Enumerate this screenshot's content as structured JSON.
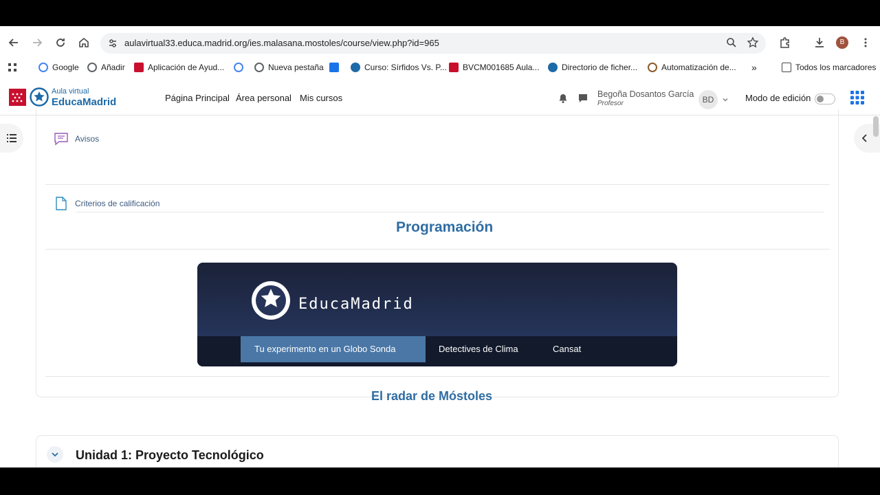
{
  "browser": {
    "url": "aulavirtual33.educa.madrid.org/ies.malasana.mostoles/course/view.php?id=965",
    "profile_initial": "B"
  },
  "bookmarks": [
    {
      "label": "Google",
      "color": "#4285f4"
    },
    {
      "label": "Añadir",
      "color": "#5f6368"
    },
    {
      "label": "Aplicación de Ayud...",
      "color": "#c8102e"
    },
    {
      "label": "",
      "color": "#4285f4"
    },
    {
      "label": "Nueva pestaña",
      "color": "#5f6368"
    },
    {
      "label": "",
      "color": "#1a73e8"
    },
    {
      "label": "Curso: Sírfidos Vs. P...",
      "color": "#1d6aa8"
    },
    {
      "label": "BVCM001685 Aula...",
      "color": "#c8102e"
    },
    {
      "label": "Directorio de ficher...",
      "color": "#1d6aa8"
    },
    {
      "label": "Automatización de...",
      "color": "#8a5a2b"
    }
  ],
  "bookmarks_all": "Todos los marcadores",
  "site": {
    "logo_small": "Aula virtual",
    "logo_big": "EducaMadrid",
    "nav": [
      "Página Principal",
      "Área personal",
      "Mis cursos"
    ],
    "user_name": "Begoña Dosantos García",
    "user_role": "Profesor",
    "user_initials": "BD",
    "edit_mode_label": "Modo de edición"
  },
  "course": {
    "activities": [
      "Avisos",
      "Criterios de calificación"
    ],
    "programacion_heading": "Programación",
    "banner": {
      "title": "EducaMadrid",
      "menu": [
        "Tu experimento en un Globo Sonda",
        "Detectives de Clima",
        "Cansat"
      ]
    },
    "radar_heading": "El radar de Móstoles",
    "unit_title": "Unidad 1: Proyecto Tecnológico"
  },
  "colors": {
    "brand_blue": "#2f6da3",
    "madrid_red": "#c8102e",
    "banner_active": "#4a77a6"
  }
}
